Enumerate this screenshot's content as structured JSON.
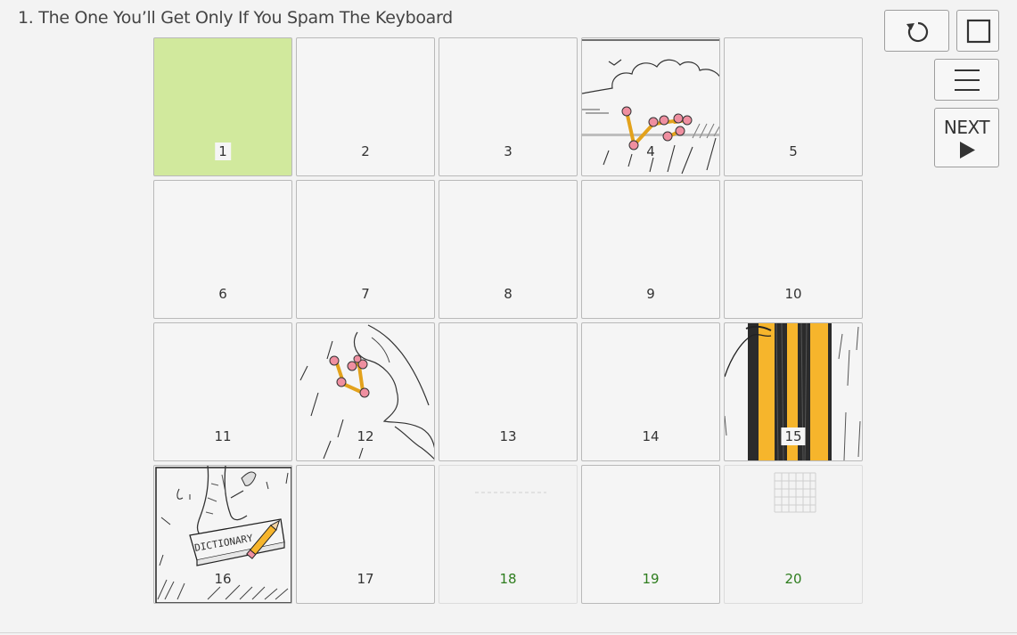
{
  "level": {
    "title": "1. The One You’ll Get Only If You Spam The Keyboard"
  },
  "controls": {
    "restart_icon": "restart-icon",
    "square_icon": "square-icon",
    "menu_icon": "hamburger-menu-icon",
    "next_label": "NEXT",
    "next_icon": "play-triangle-icon"
  },
  "tiles": [
    {
      "n": "1"
    },
    {
      "n": "2"
    },
    {
      "n": "3"
    },
    {
      "n": "4"
    },
    {
      "n": "5"
    },
    {
      "n": "6"
    },
    {
      "n": "7"
    },
    {
      "n": "8"
    },
    {
      "n": "9"
    },
    {
      "n": "10"
    },
    {
      "n": "11"
    },
    {
      "n": "12"
    },
    {
      "n": "13"
    },
    {
      "n": "14"
    },
    {
      "n": "15"
    },
    {
      "n": "16"
    },
    {
      "n": "17"
    },
    {
      "n": "18"
    },
    {
      "n": "19"
    },
    {
      "n": "20"
    }
  ],
  "drawings": {
    "dictionary_text": "DICTIONARY"
  },
  "colors": {
    "solved": "#d1e99d",
    "green_number": "#2e7d1e",
    "pencil_yellow": "#f6b52c"
  }
}
